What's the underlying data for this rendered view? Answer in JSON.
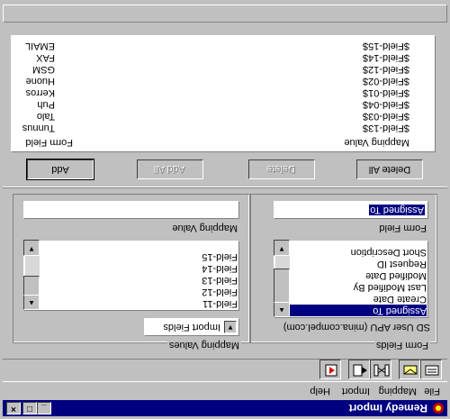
{
  "window": {
    "title": "Remedy Import",
    "buttons": {
      "minimize": "_",
      "maximize": "□",
      "close": "×"
    }
  },
  "menu": [
    "File",
    "Mapping",
    "Import",
    "Help"
  ],
  "form_fields": {
    "group_title": "Form Fields",
    "server_form": "SD User APU (mina.compel.com)",
    "list": [
      "Assigned To",
      "Create Date",
      "Last Modified By",
      "Modified Date",
      "Request ID",
      "Short Description"
    ],
    "selected_index": 0,
    "field_label": "Form Field",
    "field_value": "Assigned To"
  },
  "mapping_values": {
    "group_title": "Mapping Values",
    "select_value": "Import Fields",
    "list": [
      "Field-11",
      "Field-12",
      "Field-13",
      "Field-14",
      "Field-15"
    ],
    "field_label": "Mapping Value",
    "field_value": ""
  },
  "buttons": {
    "add": "Add",
    "add_all": "Add All",
    "delete": "Delete",
    "delete_all": "Delete All"
  },
  "mapping_table": {
    "headers": [
      "Form Field",
      "Mapping Value"
    ],
    "rows": [
      [
        "EMAIL",
        "$Field-15$"
      ],
      [
        "FAX",
        "$Field-14$"
      ],
      [
        "GSM",
        "$Field-12$"
      ],
      [
        "Huone",
        "$Field-02$"
      ],
      [
        "Kerros",
        "$Field-01$"
      ],
      [
        "Puh",
        "$Field-04$"
      ],
      [
        "Talo",
        "$Field-03$"
      ],
      [
        "Tunnus",
        "$Field-13$"
      ]
    ]
  },
  "colors": {
    "face": "#c0c0c0",
    "title_bar": "#000080",
    "selection": "#000080"
  },
  "icons": [
    "open-file-icon",
    "save-mapping-icon",
    "mapping-icon",
    "import-icon",
    "exit-icon",
    "app-icon"
  ]
}
